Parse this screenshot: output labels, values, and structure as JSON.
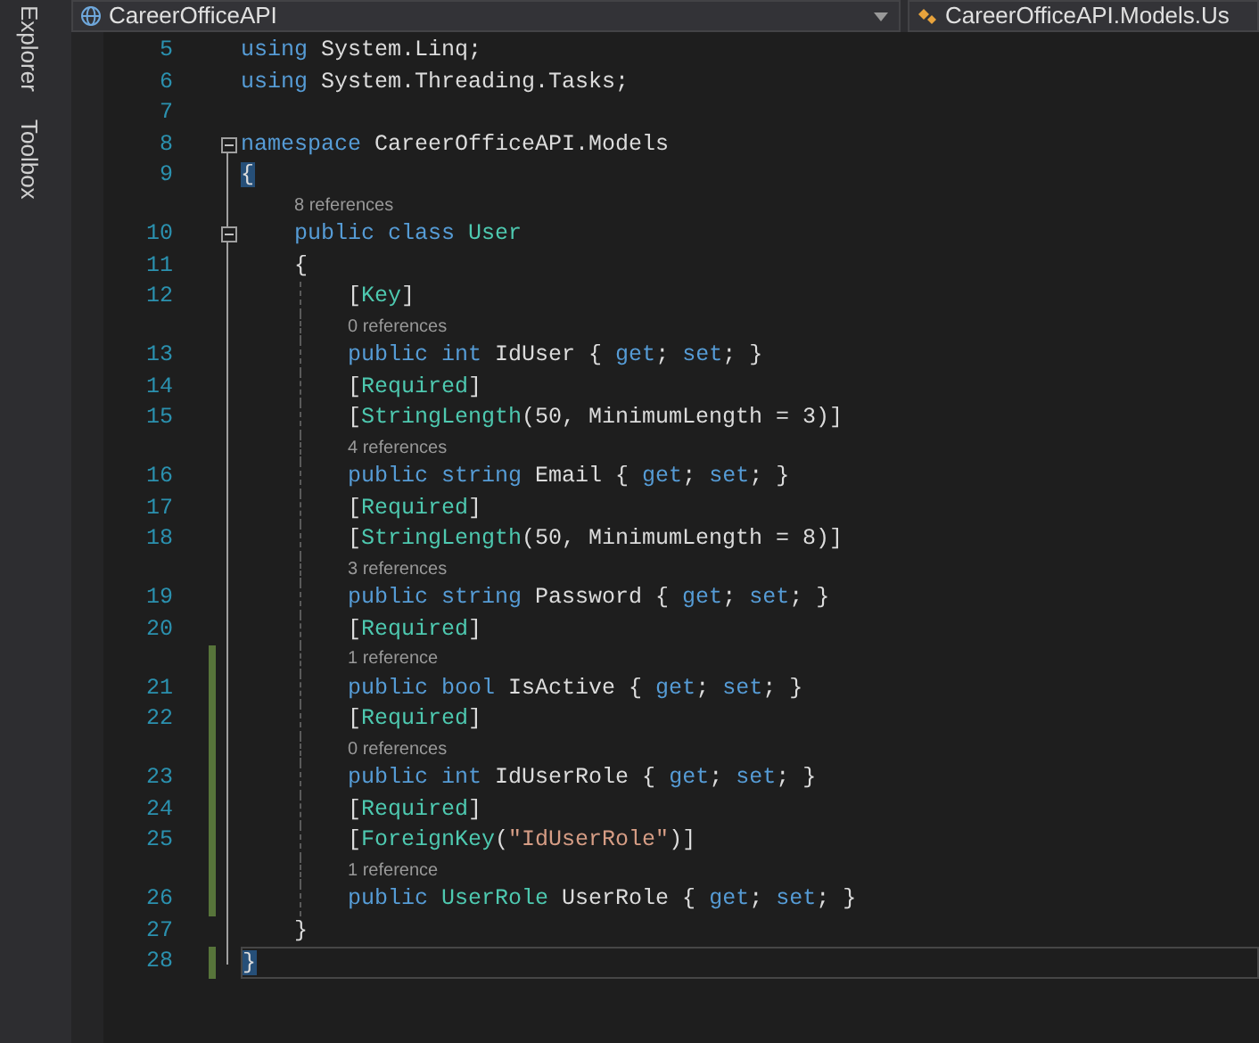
{
  "side_tabs": [
    {
      "label": "Explorer",
      "selected": false
    },
    {
      "label": "Toolbox",
      "selected": false
    }
  ],
  "navigation_bar": {
    "project": "CareerOfficeAPI",
    "type": "CareerOfficeAPI.Models.Us"
  },
  "editor": {
    "lines": [
      {
        "number": "5",
        "tokens": [
          {
            "text": "using",
            "kind": "keyword"
          },
          {
            "text": " System.Linq;",
            "kind": "plain"
          }
        ]
      },
      {
        "number": "6",
        "tokens": [
          {
            "text": "using",
            "kind": "keyword"
          },
          {
            "text": " System.Threading.Tasks;",
            "kind": "plain"
          }
        ]
      },
      {
        "number": "7"
      },
      {
        "number": "8",
        "fold": true,
        "tokens": [
          {
            "text": "namespace",
            "kind": "keyword"
          },
          {
            "text": " CareerOfficeAPI.Models",
            "kind": "plain"
          }
        ]
      },
      {
        "number": "9",
        "tokens": [
          {
            "text": "{",
            "kind": "brace_match"
          }
        ]
      },
      {
        "number": "10",
        "fold": true,
        "lens": "8 references",
        "tokens": [
          {
            "text": "    public class",
            "kind": "keyword"
          },
          {
            "text": " User",
            "kind": "type"
          }
        ]
      },
      {
        "number": "11",
        "tokens": [
          {
            "text": "    {",
            "kind": "plain"
          }
        ]
      },
      {
        "number": "12",
        "tokens": [
          {
            "text": "        [",
            "kind": "plain"
          },
          {
            "text": "Key",
            "kind": "type"
          },
          {
            "text": "]",
            "kind": "plain"
          }
        ]
      },
      {
        "number": "13",
        "lens": "0 references",
        "tokens": [
          {
            "text": "        public int",
            "kind": "keyword"
          },
          {
            "text": " IdUser { ",
            "kind": "plain"
          },
          {
            "text": "get",
            "kind": "keyword"
          },
          {
            "text": "; ",
            "kind": "plain"
          },
          {
            "text": "set",
            "kind": "keyword"
          },
          {
            "text": "; }",
            "kind": "plain"
          }
        ]
      },
      {
        "number": "14",
        "tokens": [
          {
            "text": "        [",
            "kind": "plain"
          },
          {
            "text": "Required",
            "kind": "type"
          },
          {
            "text": "]",
            "kind": "plain"
          }
        ]
      },
      {
        "number": "15",
        "tokens": [
          {
            "text": "        [",
            "kind": "plain"
          },
          {
            "text": "StringLength",
            "kind": "type"
          },
          {
            "text": "(50, MinimumLength = 3)]",
            "kind": "plain"
          }
        ]
      },
      {
        "number": "16",
        "lens": "4 references",
        "tokens": [
          {
            "text": "        public string",
            "kind": "keyword"
          },
          {
            "text": " Email { ",
            "kind": "plain"
          },
          {
            "text": "get",
            "kind": "keyword"
          },
          {
            "text": "; ",
            "kind": "plain"
          },
          {
            "text": "set",
            "kind": "keyword"
          },
          {
            "text": "; }",
            "kind": "plain"
          }
        ]
      },
      {
        "number": "17",
        "tokens": [
          {
            "text": "        [",
            "kind": "plain"
          },
          {
            "text": "Required",
            "kind": "type"
          },
          {
            "text": "]",
            "kind": "plain"
          }
        ]
      },
      {
        "number": "18",
        "tokens": [
          {
            "text": "        [",
            "kind": "plain"
          },
          {
            "text": "StringLength",
            "kind": "type"
          },
          {
            "text": "(50, MinimumLength = 8)]",
            "kind": "plain"
          }
        ]
      },
      {
        "number": "19",
        "lens": "3 references",
        "tokens": [
          {
            "text": "        public string",
            "kind": "keyword"
          },
          {
            "text": " Password { ",
            "kind": "plain"
          },
          {
            "text": "get",
            "kind": "keyword"
          },
          {
            "text": "; ",
            "kind": "plain"
          },
          {
            "text": "set",
            "kind": "keyword"
          },
          {
            "text": "; }",
            "kind": "plain"
          }
        ]
      },
      {
        "number": "20",
        "tokens": [
          {
            "text": "        [",
            "kind": "plain"
          },
          {
            "text": "Required",
            "kind": "type"
          },
          {
            "text": "]",
            "kind": "plain"
          }
        ]
      },
      {
        "number": "21",
        "changed": true,
        "lens": "1 reference",
        "tokens": [
          {
            "text": "        public bool",
            "kind": "keyword"
          },
          {
            "text": " IsActive { ",
            "kind": "plain"
          },
          {
            "text": "get",
            "kind": "keyword"
          },
          {
            "text": "; ",
            "kind": "plain"
          },
          {
            "text": "set",
            "kind": "keyword"
          },
          {
            "text": "; }",
            "kind": "plain"
          }
        ]
      },
      {
        "number": "22",
        "changed": true,
        "tokens": [
          {
            "text": "        [",
            "kind": "plain"
          },
          {
            "text": "Required",
            "kind": "type"
          },
          {
            "text": "]",
            "kind": "plain"
          }
        ]
      },
      {
        "number": "23",
        "changed": true,
        "lens": "0 references",
        "tokens": [
          {
            "text": "        public int",
            "kind": "keyword"
          },
          {
            "text": " IdUserRole { ",
            "kind": "plain"
          },
          {
            "text": "get",
            "kind": "keyword"
          },
          {
            "text": "; ",
            "kind": "plain"
          },
          {
            "text": "set",
            "kind": "keyword"
          },
          {
            "text": "; }",
            "kind": "plain"
          }
        ]
      },
      {
        "number": "24",
        "changed": true,
        "tokens": [
          {
            "text": "        [",
            "kind": "plain"
          },
          {
            "text": "Required",
            "kind": "type"
          },
          {
            "text": "]",
            "kind": "plain"
          }
        ]
      },
      {
        "number": "25",
        "changed": true,
        "tokens": [
          {
            "text": "        [",
            "kind": "plain"
          },
          {
            "text": "ForeignKey",
            "kind": "type"
          },
          {
            "text": "(",
            "kind": "plain"
          },
          {
            "text": "\"IdUserRole\"",
            "kind": "string"
          },
          {
            "text": ")]",
            "kind": "plain"
          }
        ]
      },
      {
        "number": "26",
        "changed": true,
        "lens": "1 reference",
        "tokens": [
          {
            "text": "        public",
            "kind": "keyword"
          },
          {
            "text": " UserRole",
            "kind": "type"
          },
          {
            "text": " UserRole { ",
            "kind": "plain"
          },
          {
            "text": "get",
            "kind": "keyword"
          },
          {
            "text": "; ",
            "kind": "plain"
          },
          {
            "text": "set",
            "kind": "keyword"
          },
          {
            "text": "; }",
            "kind": "plain"
          }
        ]
      },
      {
        "number": "27",
        "tokens": [
          {
            "text": "    }",
            "kind": "plain"
          }
        ]
      },
      {
        "number": "28",
        "changed": true,
        "current": true,
        "tokens": [
          {
            "text": "}",
            "kind": "brace_match"
          }
        ]
      }
    ]
  }
}
